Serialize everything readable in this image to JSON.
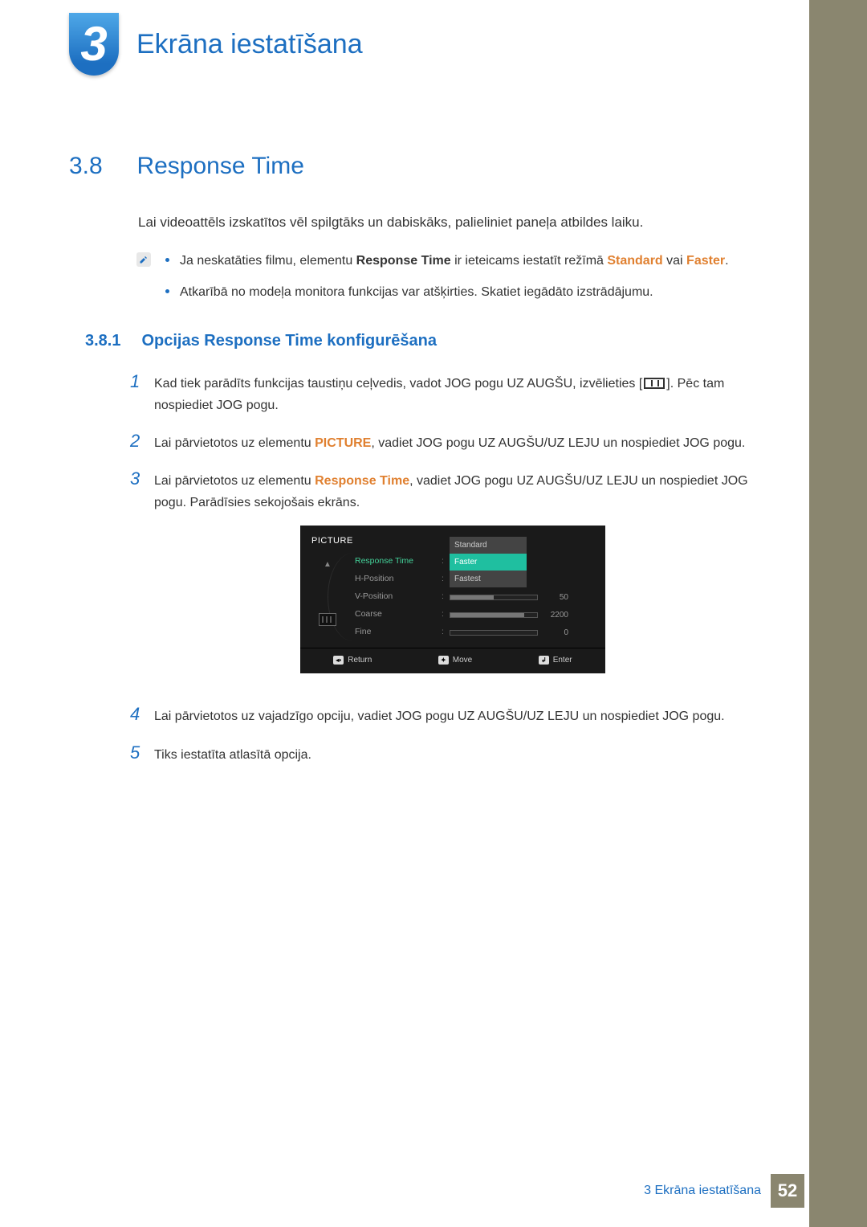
{
  "chapter": {
    "number": "3",
    "title": "Ekrāna iestatīšana"
  },
  "section": {
    "number": "3.8",
    "title": "Response Time"
  },
  "intro": "Lai videoattēls izskatītos vēl spilgtāks un dabiskāks, palieliniet paneļa atbildes laiku.",
  "notes": {
    "n1_pre": "Ja neskatāties filmu, elementu ",
    "n1_bold1": "Response Time",
    "n1_mid": " ir ieteicams iestatīt režīmā ",
    "n1_or1": "Standard",
    "n1_or_sep": " vai ",
    "n1_or2": "Faster",
    "n1_end": ".",
    "n2": "Atkarībā no modeļa monitora funkcijas var atšķirties. Skatiet iegādāto izstrādājumu."
  },
  "subsection": {
    "number": "3.8.1",
    "title": "Opcijas Response Time konfigurēšana"
  },
  "steps": {
    "s1a": "Kad tiek parādīts funkcijas taustiņu ceļvedis, vadot JOG pogu UZ AUGŠU, izvēlieties [",
    "s1b": "]. Pēc tam nospiediet JOG pogu.",
    "s2_pre": "Lai pārvietotos uz elementu ",
    "s2_bold": "PICTURE",
    "s2_post": ", vadiet JOG pogu UZ AUGŠU/UZ LEJU un nospiediet JOG pogu.",
    "s3_pre": "Lai pārvietotos uz elementu ",
    "s3_bold": "Response Time",
    "s3_post": ", vadiet JOG pogu UZ AUGŠU/UZ LEJU un nospiediet JOG pogu. Parādīsies sekojošais ekrāns.",
    "s4": "Lai pārvietotos uz vajadzīgo opciju, vadiet JOG pogu UZ AUGŠU/UZ LEJU un nospiediet JOG pogu.",
    "s5": "Tiks iestatīta atlasītā opcija.",
    "num1": "1",
    "num2": "2",
    "num3": "3",
    "num4": "4",
    "num5": "5"
  },
  "osd": {
    "header": "PICTURE",
    "row1": "Response Time",
    "row2": "H-Position",
    "row3": "V-Position",
    "row4": "Coarse",
    "row5": "Fine",
    "opt1": "Standard",
    "opt2": "Faster",
    "opt3": "Fastest",
    "val3": "50",
    "val4": "2200",
    "val5": "0",
    "foot1": "Return",
    "foot2": "Move",
    "foot3": "Enter"
  },
  "footer": {
    "text": "3 Ekrāna iestatīšana",
    "page": "52"
  }
}
